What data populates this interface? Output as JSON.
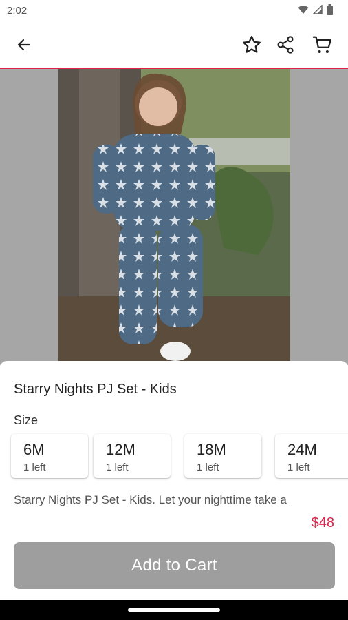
{
  "status_bar": {
    "time": "2:02"
  },
  "header": {
    "back_icon": "arrow-left-icon",
    "actions": [
      "star-icon",
      "share-icon",
      "cart-icon"
    ],
    "accent_color": "#e0244e"
  },
  "product": {
    "title": "Starry Nights PJ Set - Kids",
    "size_label": "Size",
    "sizes": [
      {
        "name": "6M",
        "stock": "1 left"
      },
      {
        "name": "12M",
        "stock": "1 left"
      },
      {
        "name": "18M",
        "stock": "1 left"
      },
      {
        "name": "24M",
        "stock": "1 left"
      }
    ],
    "description": "Starry Nights PJ Set - Kids. Let your nighttime take a",
    "price": "$48"
  },
  "footer": {
    "add_to_cart_label": "Add to Cart"
  }
}
